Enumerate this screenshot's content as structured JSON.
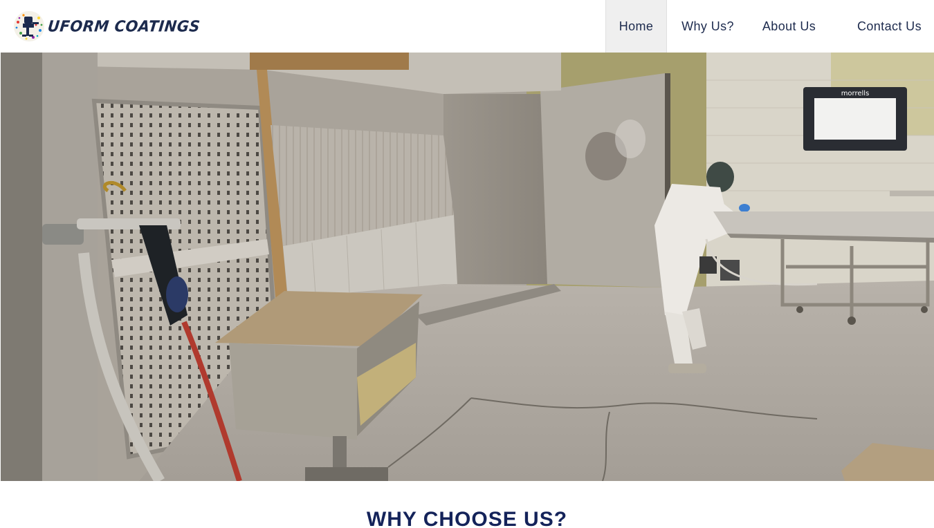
{
  "header": {
    "logo_text": "UFORM COATINGS",
    "logo_icon": "paint-spray-figure-logo"
  },
  "nav": {
    "items": [
      {
        "label": "Home",
        "active": true
      },
      {
        "label": "Why Us?",
        "active": false
      },
      {
        "label": "About Us",
        "active": false
      },
      {
        "label": "Contact Us",
        "active": false
      }
    ]
  },
  "hero": {
    "image_subject": "spray-paint-booth-with-worker",
    "sign_text": "morrells"
  },
  "section": {
    "title": "WHY CHOOSE US?"
  },
  "colors": {
    "nav_text": "#1c2a4d",
    "title_text": "#14235a",
    "active_nav_bg": "#efefef"
  }
}
